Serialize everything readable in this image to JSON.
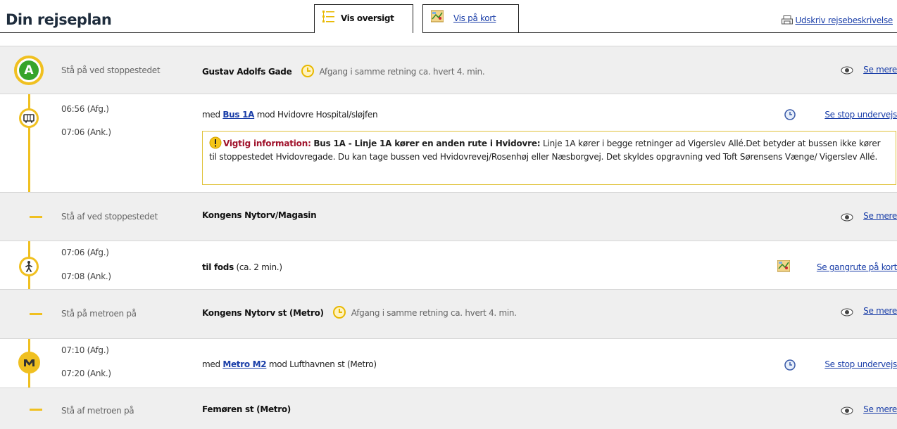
{
  "header": {
    "title": "Din rejseplan",
    "tabs": [
      {
        "label": "Vis oversigt",
        "active": true,
        "icon": "list-icon"
      },
      {
        "label": "Vis på kort",
        "active": false,
        "icon": "map-icon"
      }
    ],
    "print_label": "Udskriv rejsebeskrivelse"
  },
  "colors": {
    "route_yellow": "#f0c020",
    "link_blue": "#1a3ea8",
    "warning_red": "#a0122b"
  },
  "rows": [
    {
      "type": "stop",
      "left": "Stå på ved stoppestedet",
      "stop": "Gustav Adolfs Gade",
      "frequency": "Afgang i samme retning ca. hvert 4. min.",
      "right": "Se mere",
      "node": "A"
    },
    {
      "type": "leg",
      "dep": "06:56 (Afg.)",
      "arr": "07:06 (Ank.)",
      "prefix": "med",
      "line": "Bus 1A",
      "suffix": "mod Hvidovre Hospital/sløjfen",
      "right": "Se stop undervejs",
      "icon": "bus-icon",
      "warning": {
        "title": "Vigtig information:",
        "bold": "Bus 1A - Linje 1A kører en anden rute i Hvidovre:",
        "text": "Linje 1A kører i begge retninger ad Vigerslev Allé.Det betyder at bussen ikke kører til stoppestedet Hvidovregade. Du kan tage bussen ved Hvidovrevej/Rosenhøj eller Næsborgvej. Det skyldes opgravning ved Toft Sørensens Vænge/ Vigerslev Allé."
      }
    },
    {
      "type": "stop",
      "left": "Stå af ved stoppestedet",
      "stop": "Kongens Nytorv/Magasin",
      "right": "Se mere"
    },
    {
      "type": "walk",
      "dep": "07:06 (Afg.)",
      "arr": "07:08 (Ank.)",
      "bold": "til fods",
      "suffix": "(ca. 2 min.)",
      "right": "Se gangrute på kort",
      "icon": "walk-icon"
    },
    {
      "type": "stop",
      "left": "Stå på metroen på",
      "stop": "Kongens Nytorv st (Metro)",
      "frequency": "Afgang i samme retning ca. hvert 4. min.",
      "right": "Se mere"
    },
    {
      "type": "leg",
      "dep": "07:10 (Afg.)",
      "arr": "07:20 (Ank.)",
      "prefix": "med",
      "line": "Metro M2",
      "suffix": "mod Lufthavnen st (Metro)",
      "right": "Se stop undervejs",
      "icon": "metro-icon"
    },
    {
      "type": "stop",
      "left": "Stå af metroen på",
      "stop": "Femøren st (Metro)",
      "right": "Se mere"
    }
  ]
}
